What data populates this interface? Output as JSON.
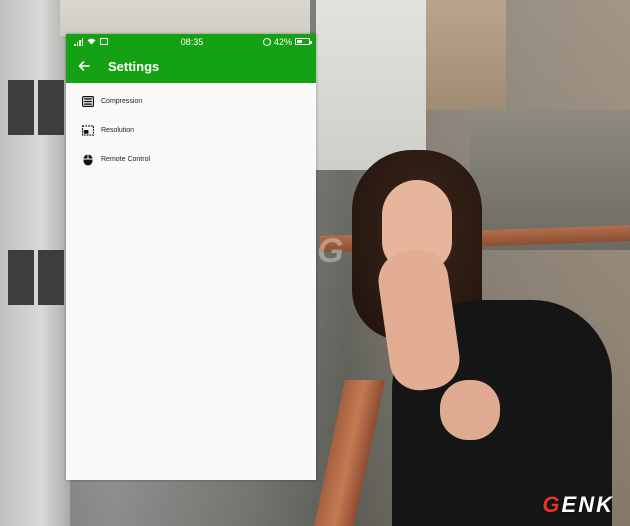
{
  "status_bar": {
    "time": "08:35",
    "battery_text": "42%",
    "battery_level": 0.42
  },
  "app_bar": {
    "title": "Settings",
    "back_icon": "arrow-left-icon"
  },
  "settings": {
    "items": [
      {
        "label": "Compression",
        "icon": "compress-icon"
      },
      {
        "label": "Resolution",
        "icon": "resolution-icon"
      },
      {
        "label": "Remote Control",
        "icon": "mouse-icon"
      }
    ]
  },
  "watermark": {
    "genk": "GENK"
  },
  "colors": {
    "primary": "#14a114",
    "background": "#fafafa",
    "text": "#222222"
  }
}
